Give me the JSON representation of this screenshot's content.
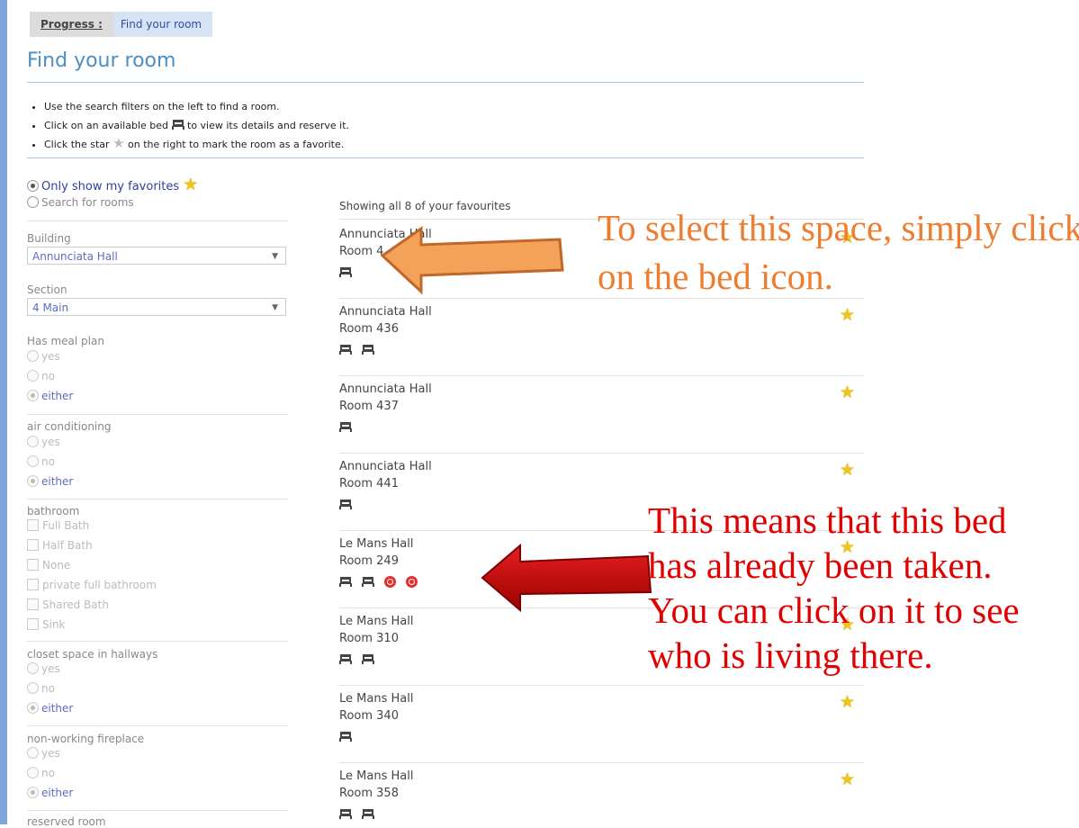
{
  "progress": {
    "label": "Progress :",
    "step": "Find your room"
  },
  "page_title": "Find your room",
  "instructions": [
    {
      "before": "Use the search filters on the left to find a room.",
      "after": ""
    },
    {
      "before": "Click on an available bed",
      "after": "to view its details and reserve it."
    },
    {
      "before": "Click the star",
      "after": "on the right to mark the room as a favorite."
    }
  ],
  "mode": {
    "favorites_label": "Only show my favorites",
    "search_label": "Search for rooms",
    "selected": "favorites"
  },
  "filters": {
    "building": {
      "label": "Building",
      "value": "Annunciata Hall"
    },
    "section": {
      "label": "Section",
      "value": "4 Main"
    },
    "meal_plan": {
      "label": "Has meal plan",
      "options": [
        "yes",
        "no",
        "either"
      ],
      "selected": "either"
    },
    "air_conditioning": {
      "label": "air conditioning",
      "options": [
        "yes",
        "no",
        "either"
      ],
      "selected": "either"
    },
    "bathroom": {
      "label": "bathroom",
      "options": [
        "Full Bath",
        "Half Bath",
        "None",
        "private full bathroom",
        "Shared Bath",
        "Sink"
      ]
    },
    "closet_space": {
      "label": "closet space in hallways",
      "options": [
        "yes",
        "no",
        "either"
      ],
      "selected": "either"
    },
    "fireplace": {
      "label": "non-working fireplace",
      "options": [
        "yes",
        "no",
        "either"
      ],
      "selected": "either"
    },
    "reserved_room": {
      "label": "reserved room"
    }
  },
  "results": {
    "showing": "Showing all 8 of your favourites",
    "rooms": [
      {
        "hall": "Annunciata Hall",
        "room": "Room 4",
        "beds": [
          "available"
        ]
      },
      {
        "hall": "Annunciata Hall",
        "room": "Room 436",
        "beds": [
          "available",
          "available"
        ]
      },
      {
        "hall": "Annunciata Hall",
        "room": "Room 437",
        "beds": [
          "available"
        ]
      },
      {
        "hall": "Annunciata Hall",
        "room": "Room 441",
        "beds": [
          "available"
        ]
      },
      {
        "hall": "Le Mans Hall",
        "room": "Room 249",
        "beds": [
          "available",
          "available",
          "taken",
          "taken"
        ]
      },
      {
        "hall": "Le Mans Hall",
        "room": "Room 310",
        "beds": [
          "available",
          "available"
        ]
      },
      {
        "hall": "Le Mans Hall",
        "room": "Room 340",
        "beds": [
          "available"
        ]
      },
      {
        "hall": "Le Mans Hall",
        "room": "Room 358",
        "beds": [
          "available",
          "available"
        ]
      }
    ]
  },
  "annotations": {
    "select_space": "To select this space, simply click on the bed icon.",
    "taken_lines": [
      "This means that this bed",
      "has already been taken.",
      "You can click on it to see",
      "who is living there."
    ]
  },
  "colors": {
    "select_note": "#ed7d31",
    "taken_note": "#e00000",
    "accent": "#4a8ec2",
    "star": "#f0c419"
  }
}
